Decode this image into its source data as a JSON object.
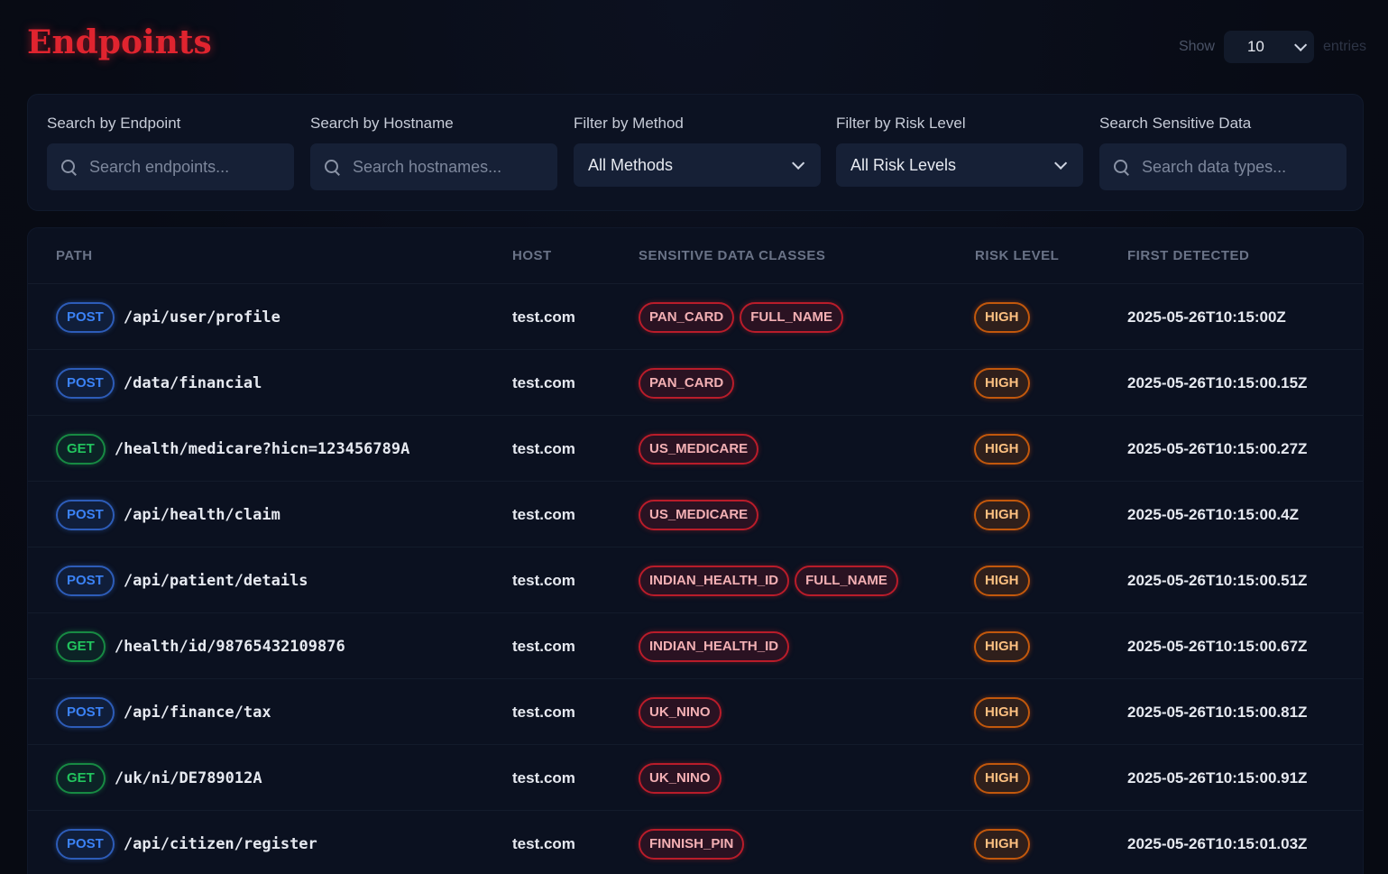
{
  "header": {
    "title": "Endpoints",
    "show_label": "Show",
    "page_size": "10",
    "entries_label": "entries"
  },
  "filters": {
    "endpoint": {
      "label": "Search by Endpoint",
      "placeholder": "Search endpoints..."
    },
    "hostname": {
      "label": "Search by Hostname",
      "placeholder": "Search hostnames..."
    },
    "method": {
      "label": "Filter by Method",
      "value": "All Methods"
    },
    "risk": {
      "label": "Filter by Risk Level",
      "value": "All Risk Levels"
    },
    "sensitive": {
      "label": "Search Sensitive Data",
      "placeholder": "Search data types..."
    }
  },
  "table": {
    "columns": [
      "PATH",
      "HOST",
      "SENSITIVE DATA CLASSES",
      "RISK LEVEL",
      "FIRST DETECTED"
    ],
    "rows": [
      {
        "method": "POST",
        "path": "/api/user/profile",
        "host": "test.com",
        "classes": [
          "PAN_CARD",
          "FULL_NAME"
        ],
        "risk": "HIGH",
        "detected": "2025-05-26T10:15:00Z"
      },
      {
        "method": "POST",
        "path": "/data/financial",
        "host": "test.com",
        "classes": [
          "PAN_CARD"
        ],
        "risk": "HIGH",
        "detected": "2025-05-26T10:15:00.15Z"
      },
      {
        "method": "GET",
        "path": "/health/medicare?hicn=123456789A",
        "host": "test.com",
        "classes": [
          "US_MEDICARE"
        ],
        "risk": "HIGH",
        "detected": "2025-05-26T10:15:00.27Z"
      },
      {
        "method": "POST",
        "path": "/api/health/claim",
        "host": "test.com",
        "classes": [
          "US_MEDICARE"
        ],
        "risk": "HIGH",
        "detected": "2025-05-26T10:15:00.4Z"
      },
      {
        "method": "POST",
        "path": "/api/patient/details",
        "host": "test.com",
        "classes": [
          "INDIAN_HEALTH_ID",
          "FULL_NAME"
        ],
        "risk": "HIGH",
        "detected": "2025-05-26T10:15:00.51Z"
      },
      {
        "method": "GET",
        "path": "/health/id/98765432109876",
        "host": "test.com",
        "classes": [
          "INDIAN_HEALTH_ID"
        ],
        "risk": "HIGH",
        "detected": "2025-05-26T10:15:00.67Z"
      },
      {
        "method": "POST",
        "path": "/api/finance/tax",
        "host": "test.com",
        "classes": [
          "UK_NINO"
        ],
        "risk": "HIGH",
        "detected": "2025-05-26T10:15:00.81Z"
      },
      {
        "method": "GET",
        "path": "/uk/ni/DE789012A",
        "host": "test.com",
        "classes": [
          "UK_NINO"
        ],
        "risk": "HIGH",
        "detected": "2025-05-26T10:15:00.91Z"
      },
      {
        "method": "POST",
        "path": "/api/citizen/register",
        "host": "test.com",
        "classes": [
          "FINNISH_PIN"
        ],
        "risk": "HIGH",
        "detected": "2025-05-26T10:15:01.03Z"
      }
    ]
  },
  "colors": {
    "title": "#e0242f",
    "post": "#3b82f6",
    "get": "#22c55e",
    "data_class": "#b91c2a",
    "risk_high": "#c2580c"
  },
  "icons": {
    "search": "search-icon",
    "dropdown": "chevron-down-icon"
  }
}
